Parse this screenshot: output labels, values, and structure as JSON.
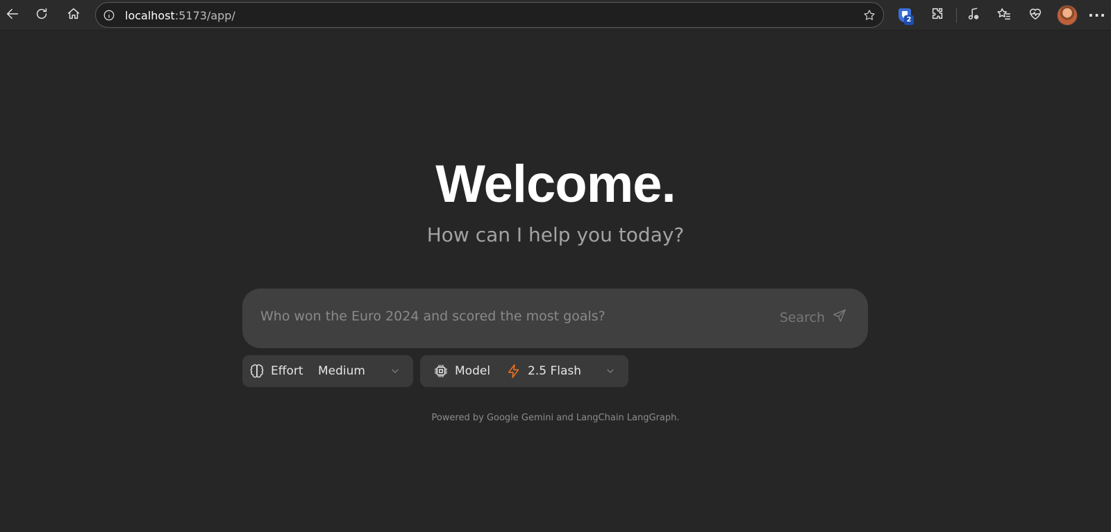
{
  "browser": {
    "url_host": "localhost",
    "url_rest": ":5173/app/",
    "extension_badge_count": "2",
    "icons": {
      "back": "back-arrow-icon",
      "reload": "reload-icon",
      "home": "home-icon",
      "site_info": "info-icon",
      "favorite": "star-icon",
      "password_ext": "password-manager-extension-icon",
      "extensions": "puzzle-piece-icon",
      "media": "music-note-icon",
      "favorites": "favorites-list-icon",
      "health": "heart-pulse-icon",
      "profile": "profile-avatar",
      "menu": "more-options-icon"
    }
  },
  "hero": {
    "title": "Welcome.",
    "subtitle": "How can I help you today?"
  },
  "composer": {
    "placeholder": "Who won the Euro 2024 and scored the most goals?",
    "value": "",
    "submit_label": "Search"
  },
  "effort_select": {
    "label": "Effort",
    "value": "Medium"
  },
  "model_select": {
    "label": "Model",
    "value": "2.5 Flash",
    "accent_color": "#f97316"
  },
  "footer": {
    "text": "Powered by Google Gemini and LangChain LangGraph."
  },
  "colors": {
    "background": "#262626",
    "composer_bg": "#404040",
    "select_bg": "#3a3a3a"
  }
}
